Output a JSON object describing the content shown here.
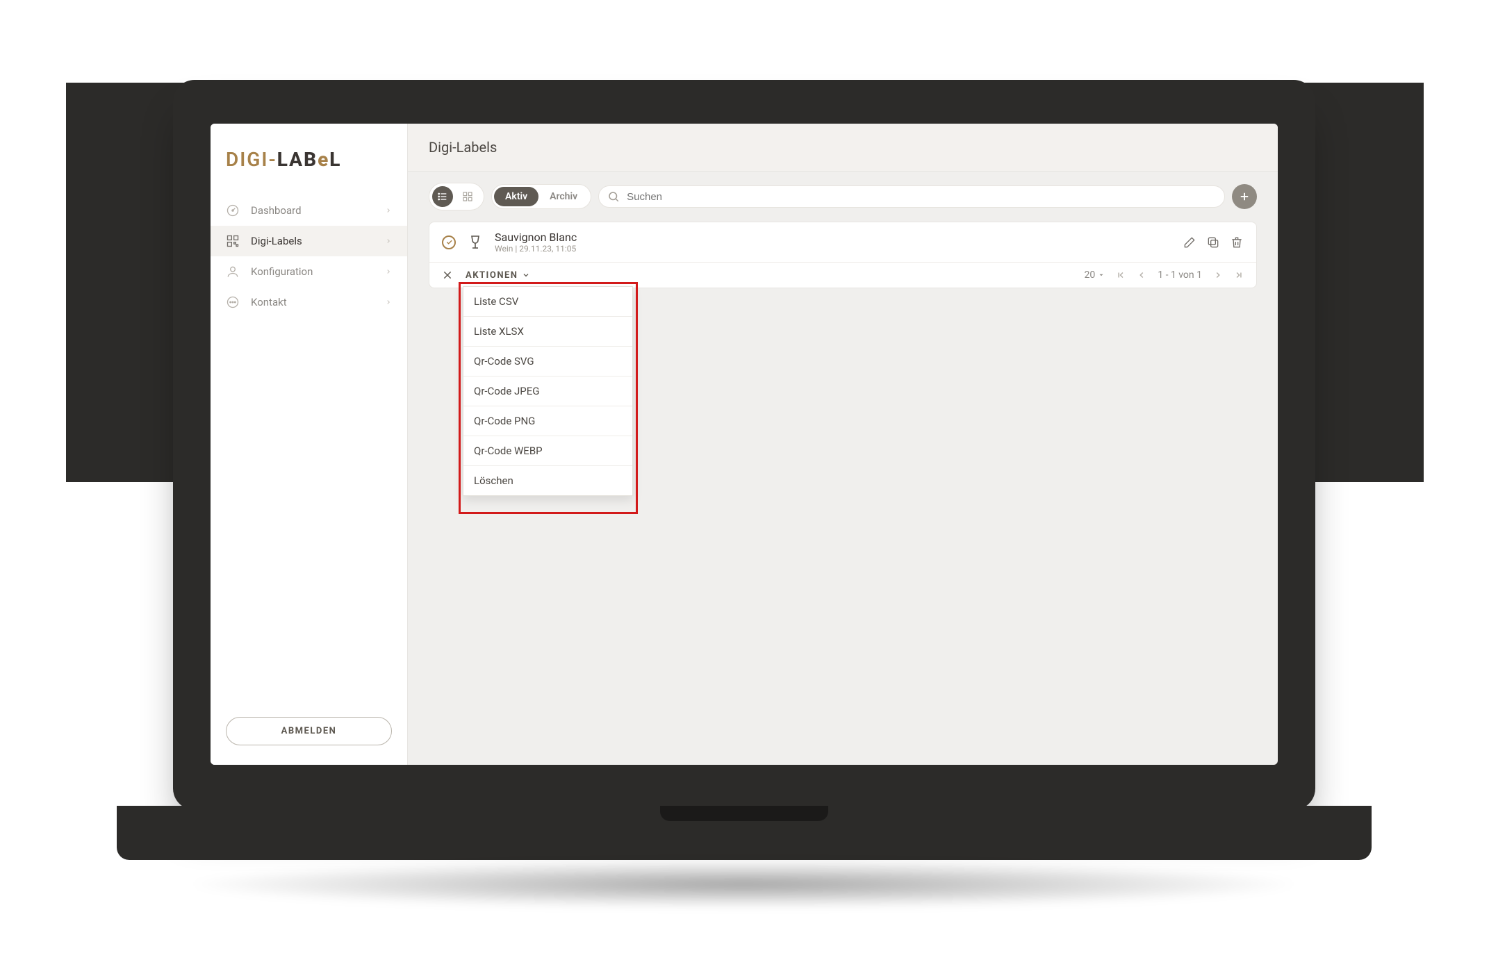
{
  "logo": {
    "part1": "DIGI",
    "sep": "-",
    "part2": "LAB",
    "e": "e",
    "part3": "L"
  },
  "sidebar": {
    "items": [
      {
        "label": "Dashboard"
      },
      {
        "label": "Digi-Labels"
      },
      {
        "label": "Konfiguration"
      },
      {
        "label": "Kontakt"
      }
    ],
    "logout": "ABMELDEN"
  },
  "header": {
    "title": "Digi-Labels"
  },
  "toolbar": {
    "tab_active": "Aktiv",
    "tab_archive": "Archiv",
    "search_placeholder": "Suchen"
  },
  "item": {
    "title": "Sauvignon Blanc",
    "subtitle": "Wein | 29.11.23, 11:05"
  },
  "footer": {
    "aktionen": "AKTIONEN",
    "page_size": "20",
    "page_info": "1 - 1 von 1"
  },
  "dropdown": {
    "items": [
      "Liste CSV",
      "Liste XLSX",
      "Qr-Code SVG",
      "Qr-Code JPEG",
      "Qr-Code PNG",
      "Qr-Code WEBP",
      "Löschen"
    ]
  },
  "colors": {
    "accent": "#A78149",
    "dark": "#2c2b29"
  }
}
